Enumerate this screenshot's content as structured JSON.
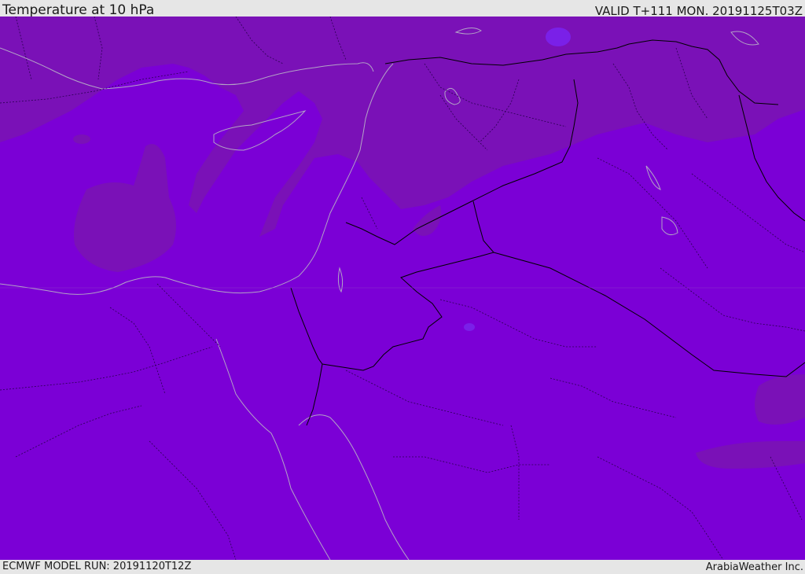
{
  "header": {
    "title": "Temperature at 10 hPa",
    "valid": "VALID T+111 MON. 20191125T03Z"
  },
  "footer": {
    "model_run": "ECMWF MODEL RUN: 20191120T12Z",
    "credit": "ArabiaWeather Inc."
  },
  "map": {
    "field": "temperature",
    "level": "10 hPa",
    "colors": {
      "base": "#7b00d6",
      "warm_band": "#7a11b7",
      "cool_spot": "#7a20e8",
      "coast": "#b3a3c6",
      "border": "#000000"
    }
  }
}
